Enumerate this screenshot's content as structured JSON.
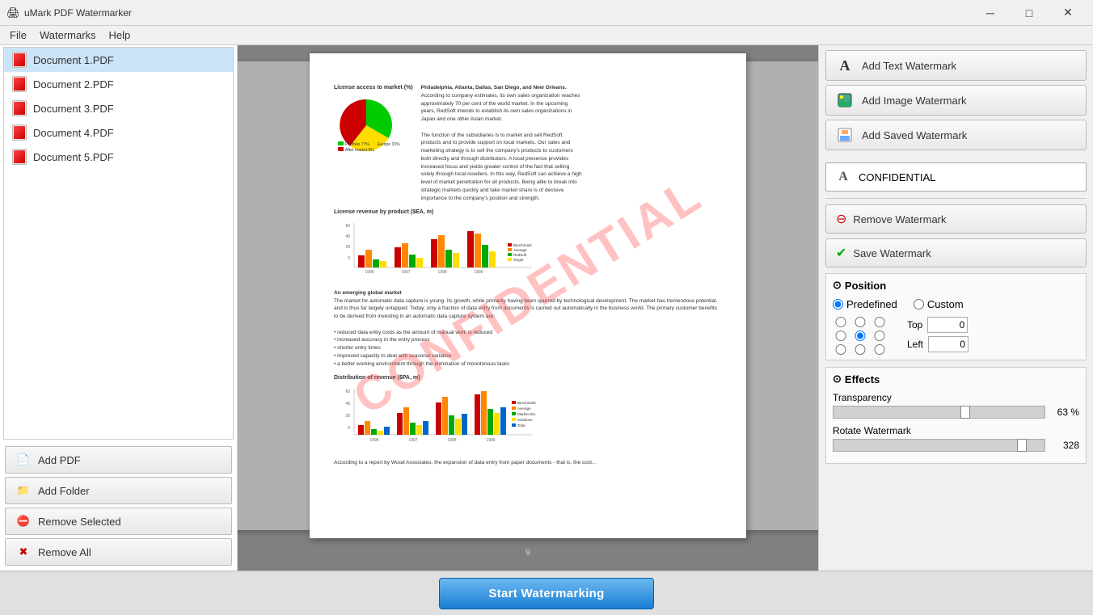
{
  "titlebar": {
    "title": "uMark PDF Watermarker",
    "icon": "🖨",
    "minimize": "─",
    "maximize": "□",
    "close": "✕"
  },
  "menubar": {
    "items": [
      "File",
      "Watermarks",
      "Help"
    ]
  },
  "sidebar": {
    "files": [
      {
        "name": "Document 1.PDF"
      },
      {
        "name": "Document 2.PDF"
      },
      {
        "name": "Document 3.PDF"
      },
      {
        "name": "Document 4.PDF"
      },
      {
        "name": "Document 5.PDF"
      }
    ],
    "buttons": {
      "add_pdf": "Add PDF",
      "add_folder": "Add Folder",
      "remove_selected": "Remove Selected",
      "remove_all": "Remove All"
    }
  },
  "preview": {
    "watermark_text": "CONFIDENTIAL",
    "page_number": "9"
  },
  "right_panel": {
    "add_text_watermark": "Add Text Watermark",
    "add_image_watermark": "Add Image Watermark",
    "add_saved_watermark": "Add Saved Watermark",
    "watermark_item": "CONFIDENTIAL",
    "remove_watermark": "Remove Watermark",
    "save_watermark": "Save Watermark",
    "position": {
      "label": "Position",
      "predefined": "Predefined",
      "custom": "Custom",
      "top_label": "Top",
      "left_label": "Left",
      "top_value": "0",
      "left_value": "0"
    },
    "effects": {
      "label": "Effects",
      "transparency_label": "Transparency",
      "transparency_value": "63 %",
      "transparency_pct": 63,
      "rotate_label": "Rotate Watermark",
      "rotate_value": "328",
      "rotate_pct": 91
    }
  },
  "bottom": {
    "start_btn": "Start Watermarking"
  }
}
